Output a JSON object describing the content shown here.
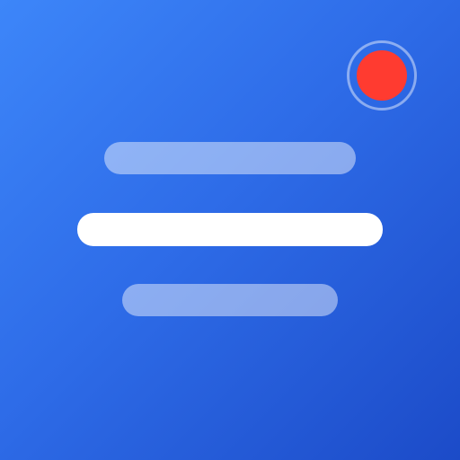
{
  "icon": {
    "name": "voice-recorder-app-icon",
    "background_colors": [
      "#3D86F9",
      "#2E6CE8",
      "#1C4BC8"
    ],
    "bars": [
      {
        "name": "text-line-top",
        "color": "rgba(255,255,255,0.45)"
      },
      {
        "name": "text-line-middle",
        "color": "#FFFFFF"
      },
      {
        "name": "text-line-bottom",
        "color": "rgba(255,255,255,0.45)"
      }
    ],
    "record_indicator": {
      "icon": "record-dot-icon",
      "color": "#FF3B30",
      "ring_color": "rgba(255,255,255,0.45)"
    }
  }
}
